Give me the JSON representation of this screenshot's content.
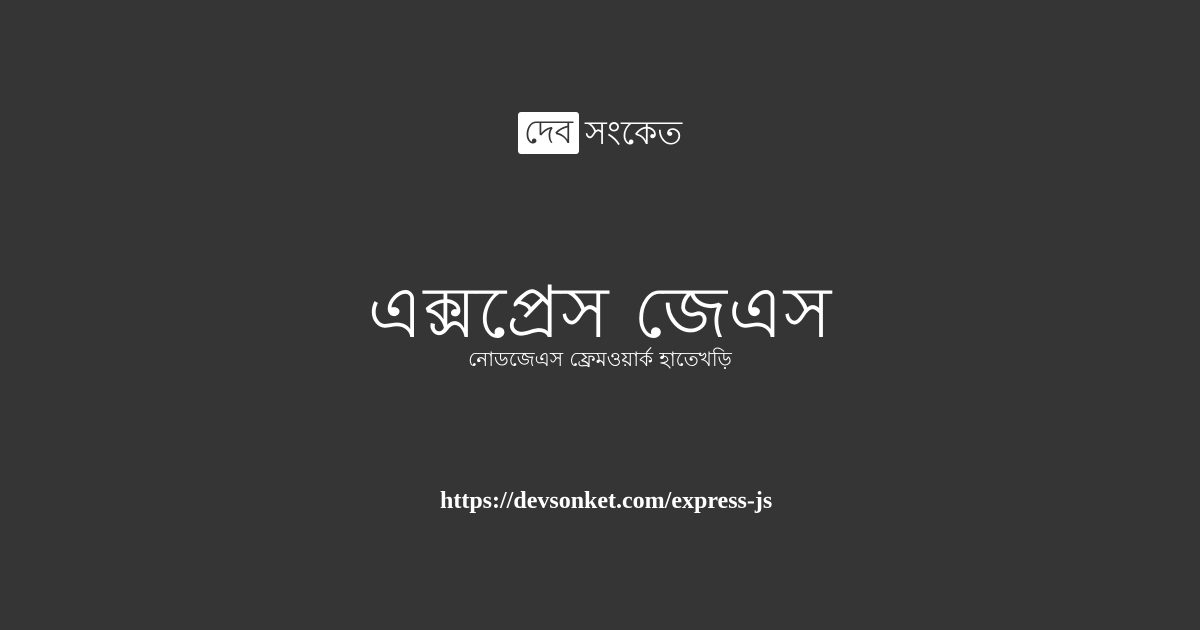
{
  "brand": {
    "badge": "দেব",
    "name": "সংকেত"
  },
  "main": {
    "title": "এক্সপ্রেস জেএস",
    "subtitle": "নোডজেএস ফ্রেমওয়ার্ক হাতেখড়ি"
  },
  "footer": {
    "url": "https://devsonket.com/express-js"
  },
  "colors": {
    "background": "#353535",
    "text": "#ffffff",
    "badge_background": "#ffffff"
  }
}
